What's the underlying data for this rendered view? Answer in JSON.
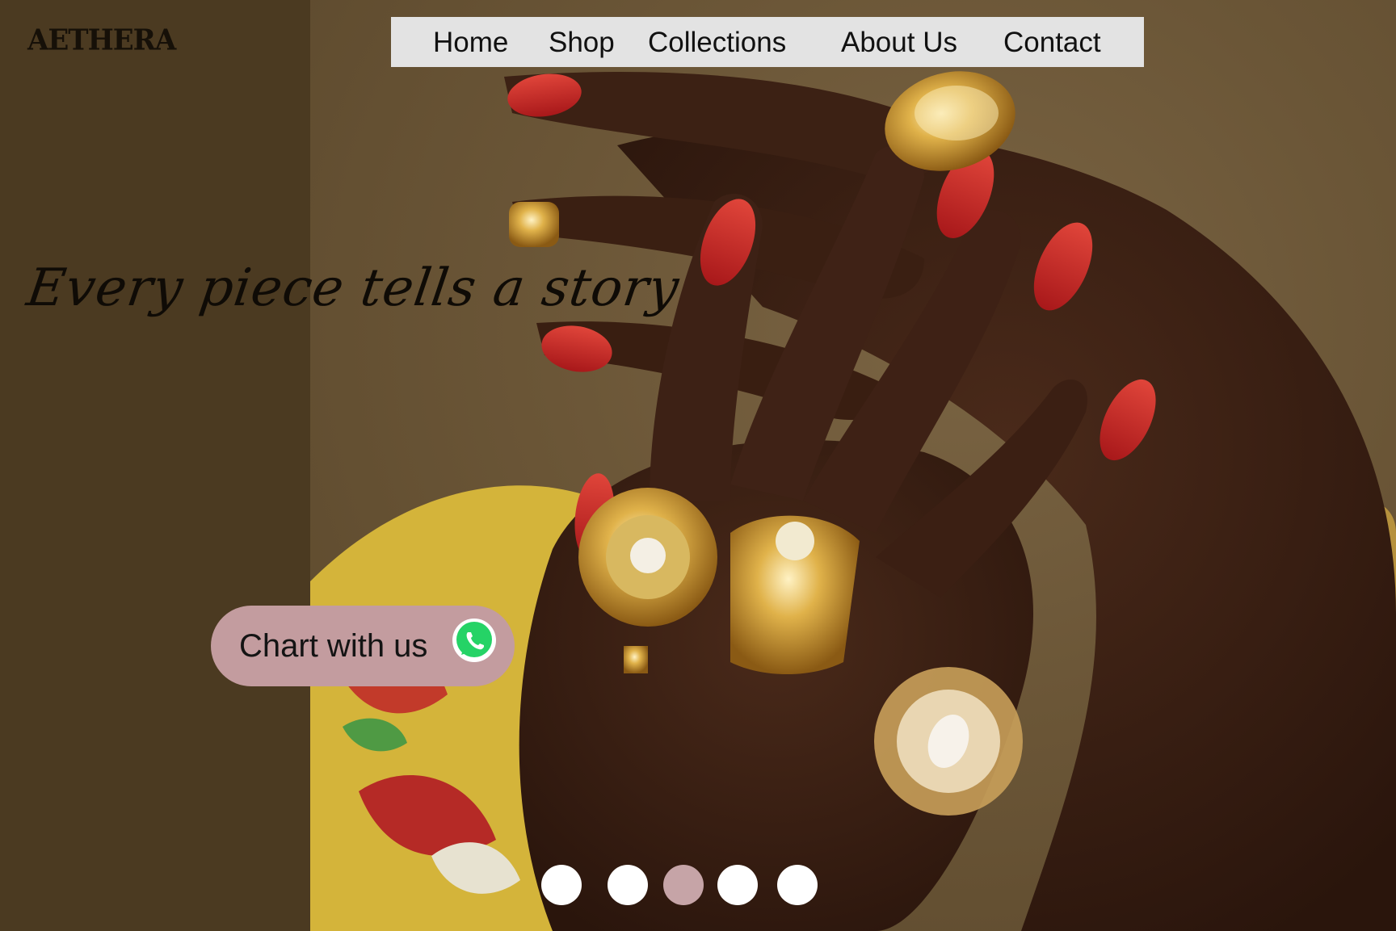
{
  "brand": {
    "logo_text": "AETHERA"
  },
  "nav": {
    "items": [
      {
        "label": "Home"
      },
      {
        "label": "Shop"
      },
      {
        "label": "Collections"
      },
      {
        "label": "About Us"
      },
      {
        "label": "Contact"
      }
    ]
  },
  "hero": {
    "tagline": "Every piece tells a story",
    "image_subject": "hands with red nails wearing ornate gold and diamond rings"
  },
  "chat_button": {
    "label": "Chart with us",
    "icon": "whatsapp-icon"
  },
  "carousel": {
    "slide_count": 5,
    "active_index": 2
  },
  "colors": {
    "left_panel": "#4b3a21",
    "nav_background": "#e3e3e3",
    "chat_button": "#c39c9f",
    "dot_active": "#c6a4a7",
    "dot_inactive": "#ffffff",
    "whatsapp": "#25d366"
  }
}
